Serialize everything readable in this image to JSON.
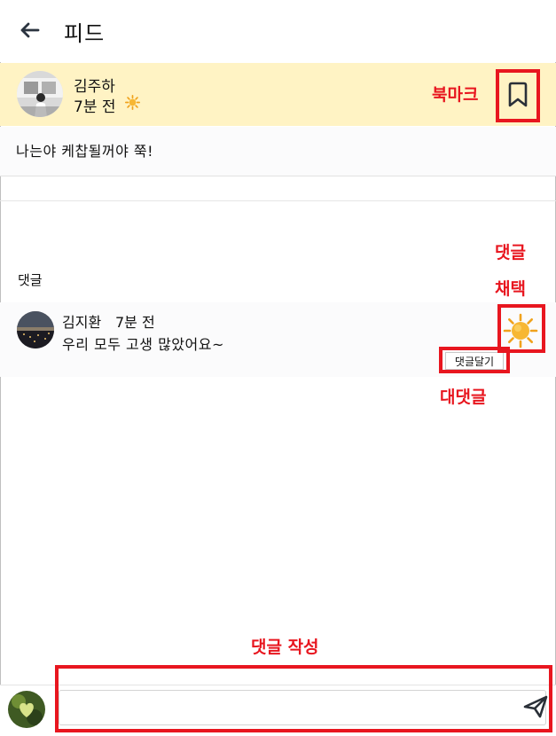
{
  "header": {
    "title": "피드"
  },
  "post": {
    "author": "김주하",
    "time": "7분 전",
    "text": "나는야 케찹될꺼야 쭉!"
  },
  "comments_section": {
    "label": "댓글",
    "items": [
      {
        "author": "김지환",
        "time": "7분 전",
        "text": "우리 모두 고생 많았어요~",
        "reply_label": "댓글달기"
      }
    ]
  },
  "comment_input": {
    "value": "",
    "placeholder": ""
  },
  "annotations": {
    "bookmark": "북마크",
    "adopt_line1": "댓글",
    "adopt_line2": "채택",
    "reply": "대댓글",
    "write": "댓글 작성"
  },
  "colors": {
    "post_highlight": "#fff3c4",
    "annotation_red": "#e8161f",
    "sun": "#f7b733"
  },
  "icons": [
    "back-arrow-icon",
    "sun-icon",
    "bookmark-icon",
    "send-icon"
  ]
}
